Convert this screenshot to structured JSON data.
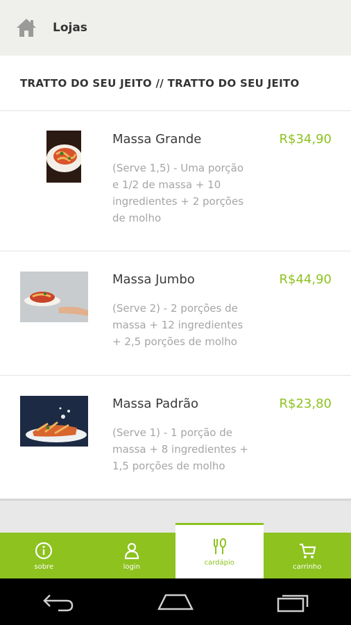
{
  "topbar": {
    "title": "Lojas"
  },
  "section": {
    "title": "TRATTO DO SEU JEITO // TRATTO DO SEU JEITO"
  },
  "menu_items": [
    {
      "name": "Massa Grande",
      "price": "R$34,90",
      "description": "(Serve 1,5) - Uma porção e 1/2 de massa + 10 ingredientes + 2 porções de molho"
    },
    {
      "name": "Massa Jumbo",
      "price": "R$44,90",
      "description": "(Serve 2) - 2 porções de massa + 12 ingredientes + 2,5 porções de molho"
    },
    {
      "name": "Massa Padrão",
      "price": "R$23,80",
      "description": "(Serve 1) - 1 porção de massa + 8 ingredientes + 1,5 porções de molho"
    }
  ],
  "tabs": [
    {
      "label": "sobre",
      "icon": "info-icon"
    },
    {
      "label": "login",
      "icon": "user-icon"
    },
    {
      "label": "cardápio",
      "icon": "cutlery-icon",
      "active": true
    },
    {
      "label": "carrinho",
      "icon": "cart-icon"
    }
  ],
  "colors": {
    "accent": "#8dc21f",
    "topbar": "#efefeb",
    "text": "#333333",
    "muted": "#a5a5a5"
  }
}
